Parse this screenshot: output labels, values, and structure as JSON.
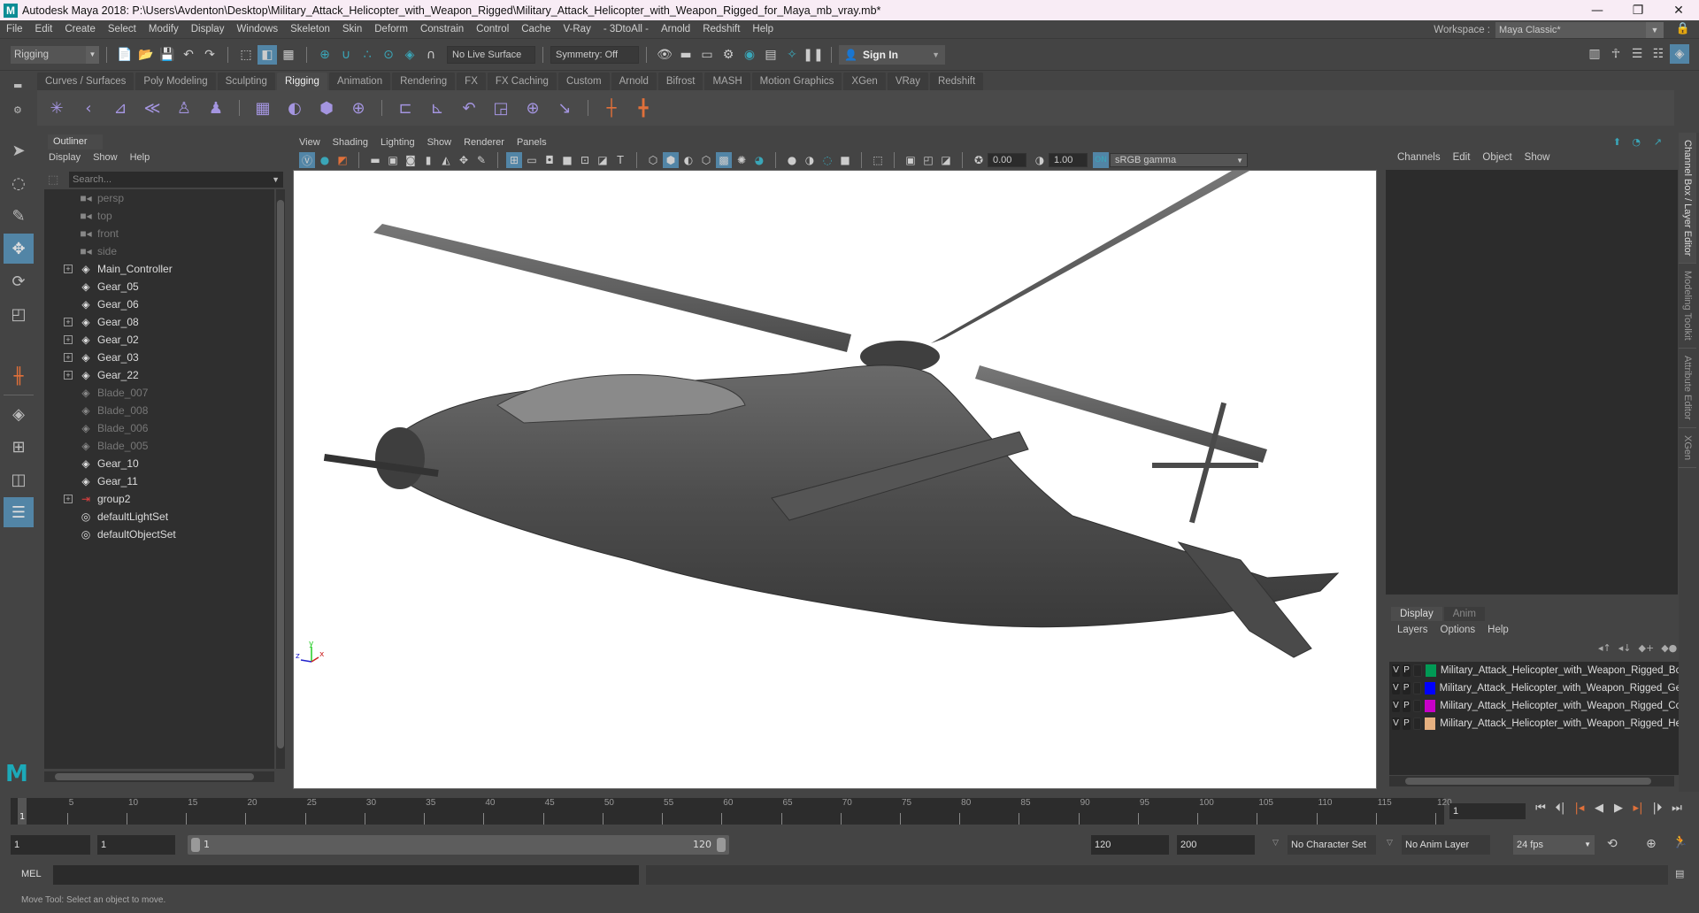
{
  "window": {
    "title": "Autodesk Maya 2018: P:\\Users\\Avdenton\\Desktop\\Military_Attack_Helicopter_with_Weapon_Rigged\\Military_Attack_Helicopter_with_Weapon_Rigged_for_Maya_mb_vray.mb*",
    "logo": "M",
    "minimize": "—",
    "maximize": "❐",
    "close": "✕"
  },
  "menubar": {
    "items": [
      "File",
      "Edit",
      "Create",
      "Select",
      "Modify",
      "Display",
      "Windows",
      "Skeleton",
      "Skin",
      "Deform",
      "Constrain",
      "Control",
      "Cache",
      "V-Ray",
      "- 3DtoAll -",
      "Arnold",
      "Redshift",
      "Help"
    ],
    "workspace_label": "Workspace :",
    "workspace_value": "Maya Classic*"
  },
  "statusline": {
    "menuset": "Rigging",
    "live_surface": "No Live Surface",
    "symmetry": "Symmetry: Off",
    "sign_in": "Sign In"
  },
  "shelf": {
    "tabs": [
      "Curves / Surfaces",
      "Poly Modeling",
      "Sculpting",
      "Rigging",
      "Animation",
      "Rendering",
      "FX",
      "FX Caching",
      "Custom",
      "Arnold",
      "Bifrost",
      "MASH",
      "Motion Graphics",
      "XGen",
      "VRay",
      "Redshift"
    ],
    "active_tab": "Rigging"
  },
  "outliner": {
    "title": "Outliner",
    "menu": [
      "Display",
      "Show",
      "Help"
    ],
    "search_placeholder": "Search...",
    "items": [
      {
        "name": "persp",
        "icon": "camera-icon",
        "expandable": false,
        "dim": true
      },
      {
        "name": "top",
        "icon": "camera-icon",
        "expandable": false,
        "dim": true
      },
      {
        "name": "front",
        "icon": "camera-icon",
        "expandable": false,
        "dim": true
      },
      {
        "name": "side",
        "icon": "camera-icon",
        "expandable": false,
        "dim": true
      },
      {
        "name": "Main_Controller",
        "icon": "transform-icon",
        "expandable": true,
        "dim": false
      },
      {
        "name": "Gear_05",
        "icon": "transform-icon",
        "expandable": false,
        "dim": false
      },
      {
        "name": "Gear_06",
        "icon": "transform-icon",
        "expandable": false,
        "dim": false
      },
      {
        "name": "Gear_08",
        "icon": "transform-icon",
        "expandable": true,
        "dim": false
      },
      {
        "name": "Gear_02",
        "icon": "transform-icon",
        "expandable": true,
        "dim": false
      },
      {
        "name": "Gear_03",
        "icon": "transform-icon",
        "expandable": true,
        "dim": false
      },
      {
        "name": "Gear_22",
        "icon": "transform-icon",
        "expandable": true,
        "dim": false
      },
      {
        "name": "Blade_007",
        "icon": "transform-icon",
        "expandable": false,
        "dim": true
      },
      {
        "name": "Blade_008",
        "icon": "transform-icon",
        "expandable": false,
        "dim": true
      },
      {
        "name": "Blade_006",
        "icon": "transform-icon",
        "expandable": false,
        "dim": true
      },
      {
        "name": "Blade_005",
        "icon": "transform-icon",
        "expandable": false,
        "dim": true
      },
      {
        "name": "Gear_10",
        "icon": "transform-icon",
        "expandable": false,
        "dim": false
      },
      {
        "name": "Gear_11",
        "icon": "transform-icon",
        "expandable": false,
        "dim": false
      },
      {
        "name": "group2",
        "icon": "group-icon",
        "expandable": true,
        "dim": false
      },
      {
        "name": "defaultLightSet",
        "icon": "set-icon",
        "expandable": false,
        "dim": false
      },
      {
        "name": "defaultObjectSet",
        "icon": "set-icon",
        "expandable": false,
        "dim": false
      }
    ]
  },
  "viewport": {
    "menu": [
      "View",
      "Shading",
      "Lighting",
      "Show",
      "Renderer",
      "Panels"
    ],
    "exposure": "0.00",
    "gamma": "1.00",
    "color_space": "sRGB gamma",
    "axis": {
      "x": "x",
      "y": "y",
      "z": "z"
    }
  },
  "channelbox": {
    "menu": [
      "Channels",
      "Edit",
      "Object",
      "Show"
    ],
    "layer_tabs": [
      "Display",
      "Anim"
    ],
    "active_layer_tab": "Display",
    "layer_menu": [
      "Layers",
      "Options",
      "Help"
    ],
    "layers": [
      {
        "v": "V",
        "p": "P",
        "color": "#009a55",
        "name": "Military_Attack_Helicopter_with_Weapon_Rigged_Bo"
      },
      {
        "v": "V",
        "p": "P",
        "color": "#0000ff",
        "name": "Military_Attack_Helicopter_with_Weapon_Rigged_Ge"
      },
      {
        "v": "V",
        "p": "P",
        "color": "#c800c8",
        "name": "Military_Attack_Helicopter_with_Weapon_Rigged_Co"
      },
      {
        "v": "V",
        "p": "P",
        "color": "#e6b080",
        "name": "Military_Attack_Helicopter_with_Weapon_Rigged_He"
      }
    ]
  },
  "sidetabs": [
    "Channel Box / Layer Editor",
    "Modeling Toolkit",
    "Attribute Editor",
    "XGen"
  ],
  "timeline": {
    "start": 1,
    "end": 120,
    "ticks": [
      "5",
      "10",
      "15",
      "20",
      "25",
      "30",
      "35",
      "40",
      "45",
      "50",
      "55",
      "60",
      "65",
      "70",
      "75",
      "80",
      "85",
      "90",
      "95",
      "100",
      "105",
      "110",
      "115",
      "120"
    ],
    "current_frame_marker": "1",
    "current_frame": "1"
  },
  "range": {
    "start_time": "1",
    "playback_start": "1",
    "slider_start": "1",
    "slider_end": "120",
    "playback_end": "120",
    "end_time": "200",
    "character_set": "No Character Set",
    "anim_layer": "No Anim Layer",
    "fps": "24 fps"
  },
  "command_line": {
    "language": "MEL",
    "value": ""
  },
  "status_message": "Move Tool: Select an object to move.",
  "colors": {
    "accent": "#5285a6",
    "teal": "#3aa6b8",
    "shelf_icon": "#a495e0",
    "orange": "#e0703a"
  }
}
